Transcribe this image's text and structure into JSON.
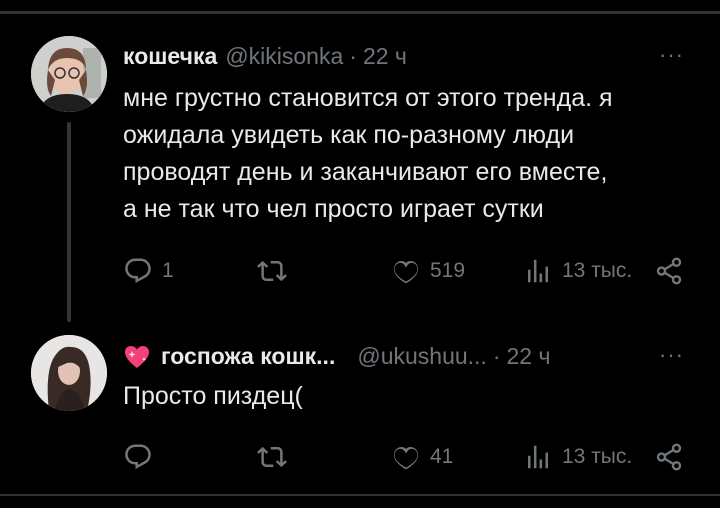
{
  "posts": [
    {
      "author_name": "кошечка",
      "handle": "@kikisonka",
      "separator": "·",
      "time": "22 ч",
      "more": "···",
      "text": "мне грустно становится от этого тренда. я\nожидала увидеть как по-разному люди\nпроводят день и заканчивают его вместе,\nа не так что чел просто играет сутки",
      "replies": "1",
      "reposts": "",
      "likes": "519",
      "views": "13 тыс."
    },
    {
      "author_name": "госпожа кошк...",
      "handle": "@ukushuu...",
      "separator": "·",
      "time": "22 ч",
      "more": "···",
      "text": "Просто пиздец(",
      "replies": "",
      "reposts": "",
      "likes": "41",
      "views": "13 тыс."
    }
  ],
  "icons": {
    "reply": "reply-icon",
    "repost": "repost-icon",
    "like": "heart-icon",
    "views": "views-icon",
    "share": "share-icon",
    "name_badge": "sparkling-heart-icon"
  },
  "colors": {
    "background": "#000000",
    "text": "#e7e9ea",
    "secondary": "#71767b",
    "divider": "#2f3336",
    "badge": "#f5407a"
  }
}
